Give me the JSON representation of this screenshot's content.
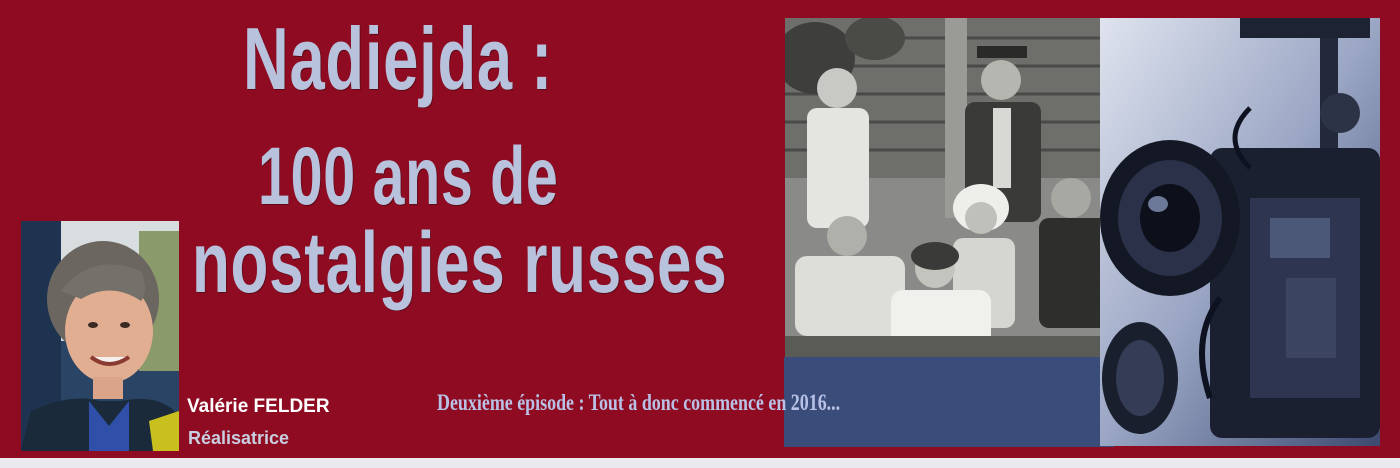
{
  "banner": {
    "title_line1": "Nadiejda :",
    "title_line2": "100 ans de",
    "title_line3": "nostalgies russes",
    "subtitle": "Deuxième épisode : Tout à donc commencé en 2016...",
    "person": {
      "name": "Valérie FELDER",
      "role": "Réalisatrice"
    },
    "colors": {
      "background": "#8e0b22",
      "title": "#b9c2dc",
      "episode_text": "#b9c2e6"
    }
  }
}
